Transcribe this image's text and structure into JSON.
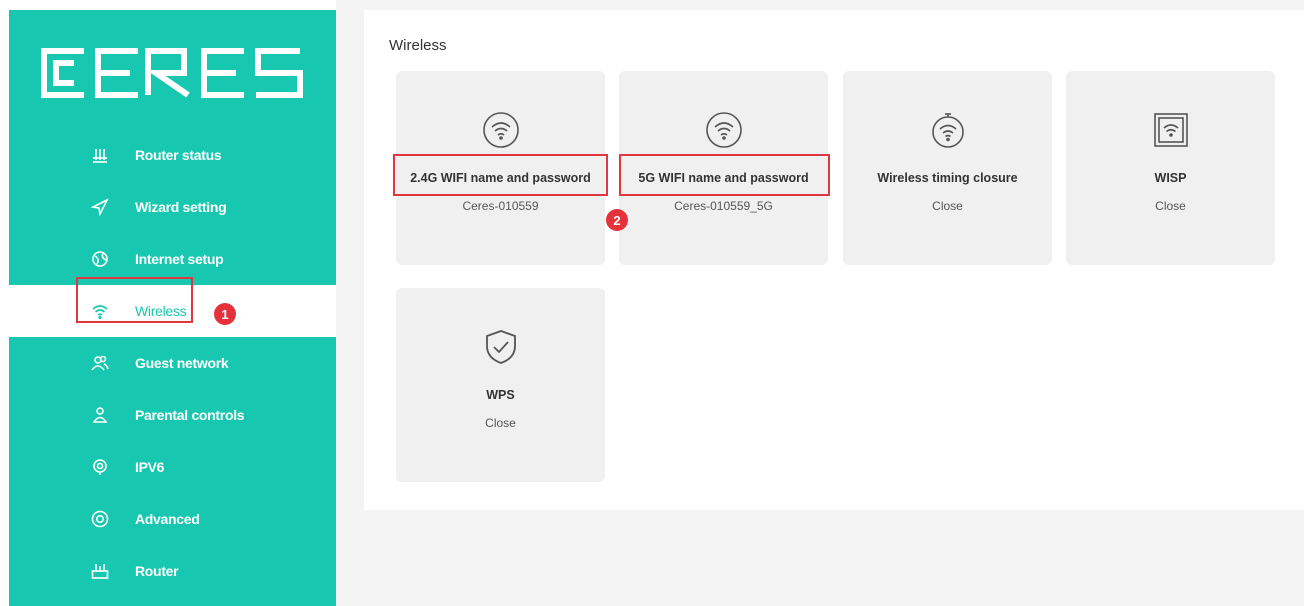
{
  "logo": {
    "text": "CERES"
  },
  "sidebar": {
    "items": [
      {
        "label": "Router status",
        "icon": "router-status-icon"
      },
      {
        "label": "Wizard setting",
        "icon": "wizard-icon"
      },
      {
        "label": "Internet setup",
        "icon": "internet-icon"
      },
      {
        "label": "Wireless",
        "icon": "wifi-icon",
        "active": true
      },
      {
        "label": "Guest network",
        "icon": "guest-icon"
      },
      {
        "label": "Parental controls",
        "icon": "parental-icon"
      },
      {
        "label": "IPV6",
        "icon": "ipv6-icon"
      },
      {
        "label": "Advanced",
        "icon": "advanced-icon"
      },
      {
        "label": "Router",
        "icon": "router-icon"
      }
    ]
  },
  "annotations": {
    "step1": "1",
    "step2": "2"
  },
  "main": {
    "title": "Wireless",
    "cards": [
      {
        "title": "2.4G WIFI name and password",
        "value": "Ceres-010559",
        "icon": "wifi-icon"
      },
      {
        "title": "5G WIFI name and password",
        "value": "Ceres-010559_5G",
        "icon": "wifi-icon"
      },
      {
        "title": "Wireless timing closure",
        "value": "Close",
        "icon": "wifi-timer-icon"
      },
      {
        "title": "WISP",
        "value": "Close",
        "icon": "wisp-icon"
      },
      {
        "title": "WPS",
        "value": "Close",
        "icon": "shield-check-icon"
      }
    ]
  },
  "colors": {
    "brand": "#17c7b0",
    "highlight": "#e0383e",
    "badge": "#e5323a"
  }
}
